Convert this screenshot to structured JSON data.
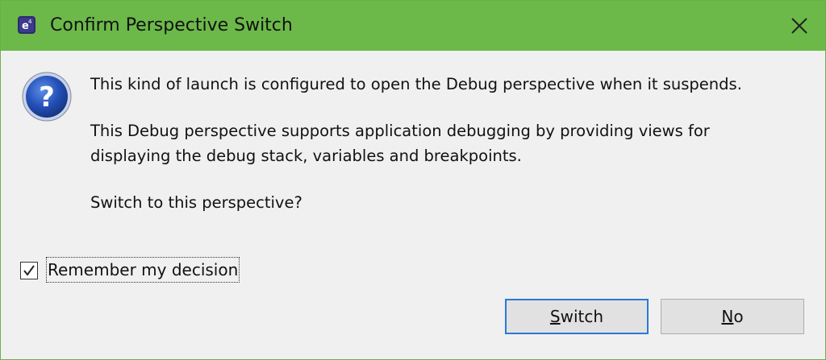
{
  "window": {
    "title": "Confirm Perspective Switch",
    "app_icon": "eclipse-e-icon",
    "close_icon": "close-x-icon",
    "accent_color": "#6cb94a"
  },
  "message": {
    "icon": "question-icon",
    "line1": "This kind of launch is configured to open the Debug perspective when it suspends.",
    "line2": "This Debug perspective supports application debugging by providing views for",
    "line3": "displaying the debug stack, variables and breakpoints.",
    "line4": "Switch to this perspective?"
  },
  "remember": {
    "label": "Remember my decision",
    "checked": true
  },
  "buttons": {
    "switch_mnemonic": "S",
    "switch_rest": "witch",
    "no_mnemonic": "N",
    "no_rest": "o"
  }
}
